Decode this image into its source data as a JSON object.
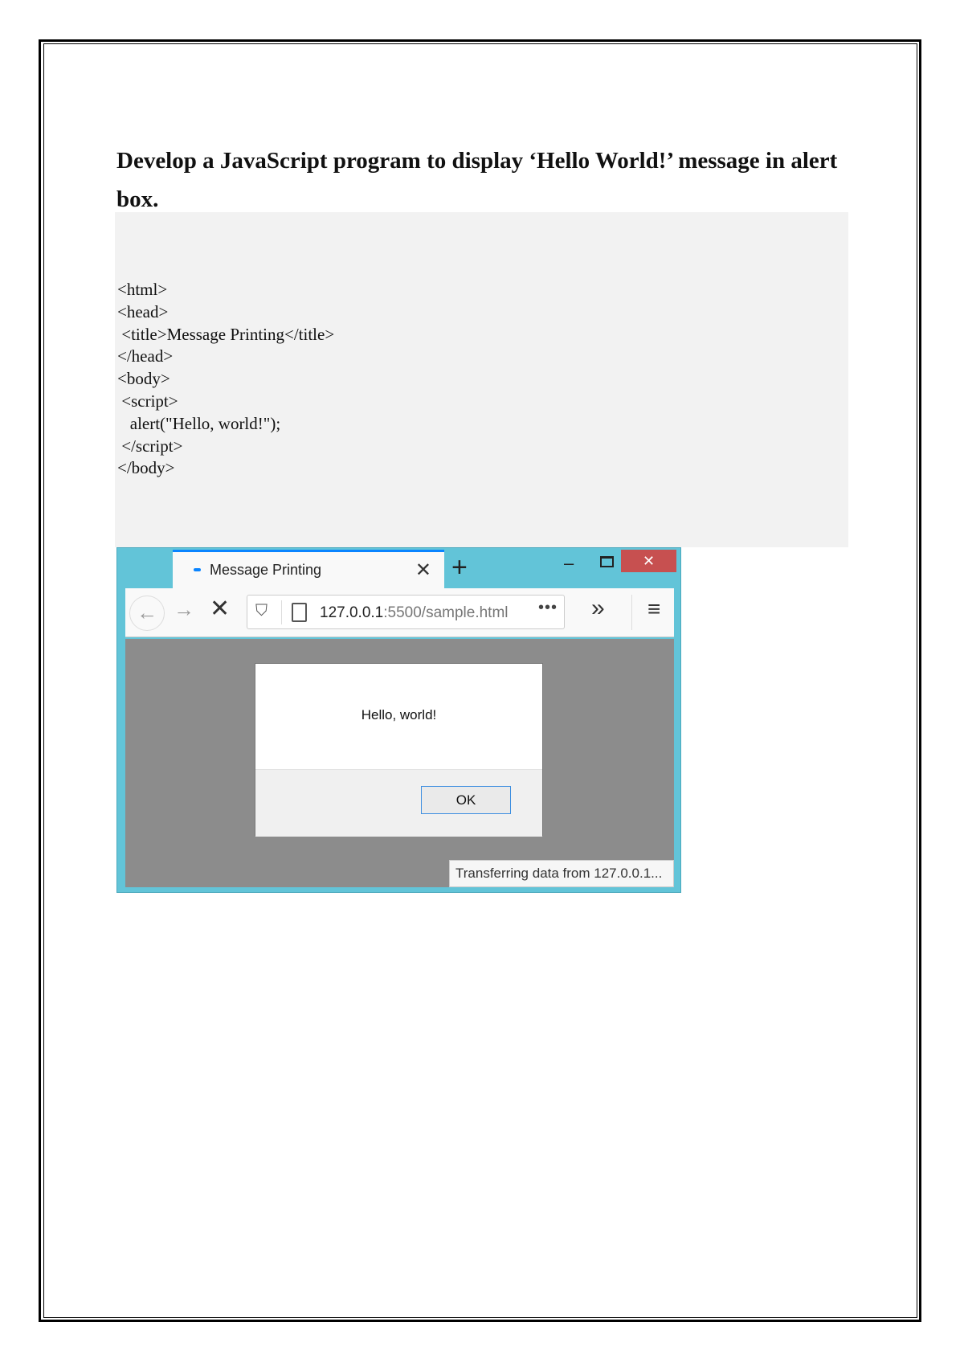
{
  "document": {
    "title": "Develop a JavaScript program to display ‘Hello World!’ message in alert box.",
    "code": "<html>\n<head>\n <title>Message Printing</title>\n</head>\n<body>\n <script>\n   alert(\"Hello, world!\");\n </script>\n</body>"
  },
  "browser": {
    "tab_title": "Message Printing",
    "tab_close": "✕",
    "new_tab": "+",
    "window_minimize": "–",
    "window_close": "✕",
    "url_host": "127.0.0.1",
    "url_rest": ":5500/sample.html",
    "page_actions": "•••",
    "overflow": "»",
    "menu": "≡",
    "back": "←",
    "forward": "→",
    "stop": "✕",
    "shield": "⛉",
    "status": "Transferring data from 127.0.0.1..."
  },
  "alert": {
    "message": "Hello, world!",
    "ok_label": "OK"
  },
  "colors": {
    "window_frame": "#62c4d8",
    "close_button": "#c75050",
    "tab_accent": "#0a84ff",
    "content_overlay": "#8c8c8c"
  }
}
